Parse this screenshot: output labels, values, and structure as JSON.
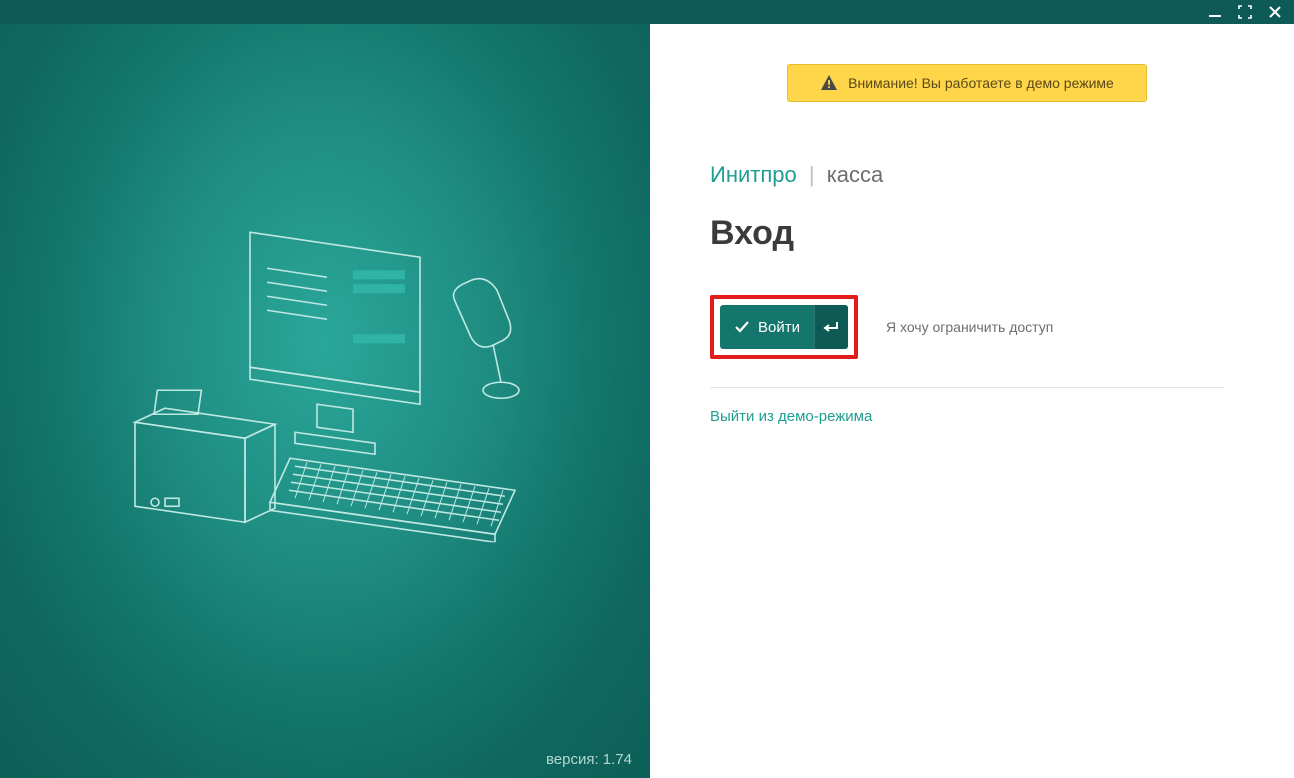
{
  "banner": {
    "text": "Внимание! Вы работаете в демо режиме"
  },
  "brand": {
    "name": "Инитпро",
    "separator": "|",
    "sub": "касса"
  },
  "heading": "Вход",
  "login_button": {
    "label": "Войти"
  },
  "restrict_link": "Я хочу ограничить доступ",
  "exit_demo_link": "Выйти из демо-режима",
  "version": {
    "prefix": "версия:",
    "value": "1.74"
  }
}
